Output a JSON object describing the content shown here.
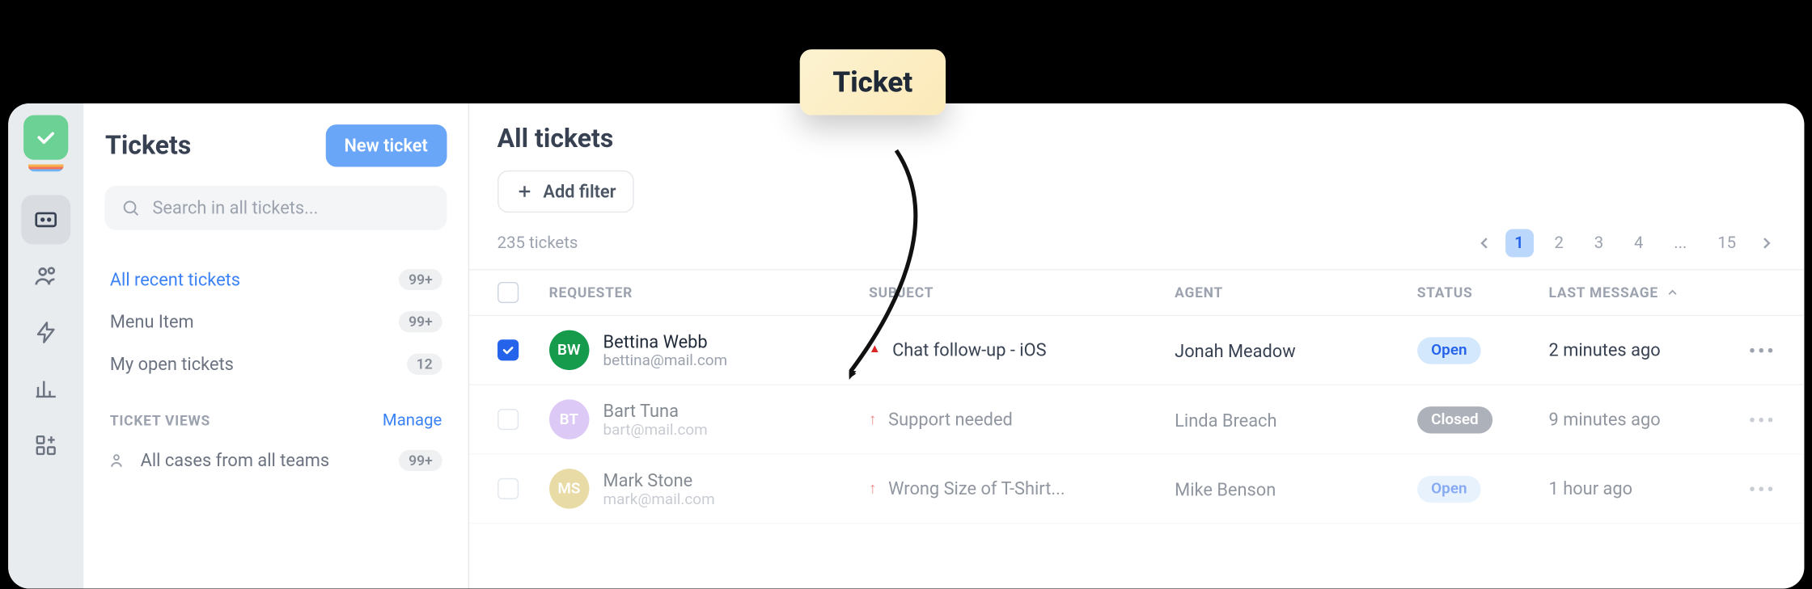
{
  "callout": {
    "label": "Ticket"
  },
  "sidebar": {
    "title": "Tickets",
    "new_button": "New ticket",
    "search_placeholder": "Search in all tickets...",
    "nav": [
      {
        "label": "All recent tickets",
        "badge": "99+",
        "active": true
      },
      {
        "label": "Menu Item",
        "badge": "99+",
        "active": false
      },
      {
        "label": "My open tickets",
        "badge": "12",
        "active": false
      }
    ],
    "views_header": "TICKET VIEWS",
    "manage": "Manage",
    "views": [
      {
        "label": "All cases from all teams",
        "badge": "99+"
      }
    ]
  },
  "main": {
    "title": "All tickets",
    "add_filter": "Add filter",
    "count": "235 tickets",
    "pages": [
      "1",
      "2",
      "3",
      "4",
      "...",
      "15"
    ],
    "active_page": "1",
    "columns": {
      "requester": "REQUESTER",
      "subject": "SUBJECT",
      "agent": "AGENT",
      "status": "STATUS",
      "last": "LAST MESSAGE"
    },
    "rows": [
      {
        "checked": true,
        "faded": false,
        "initials": "BW",
        "avatar_color": "#169b4c",
        "name": "Bettina Webb",
        "email": "bettina@mail.com",
        "priority": "high",
        "subject": "Chat follow-up - iOS",
        "agent": "Jonah Meadow",
        "status": "Open",
        "status_class": "st-open",
        "last": "2 minutes ago"
      },
      {
        "checked": false,
        "faded": true,
        "initials": "BT",
        "avatar_color": "#c39df0",
        "name": "Bart Tuna",
        "email": "bart@mail.com",
        "priority": "low",
        "subject": "Support needed",
        "agent": "Linda Breach",
        "status": "Closed",
        "status_class": "st-closed",
        "last": "9 minutes ago"
      },
      {
        "checked": false,
        "faded": true,
        "initials": "MS",
        "avatar_color": "#d7be5e",
        "name": "Mark Stone",
        "email": "mark@mail.com",
        "priority": "low",
        "subject": "Wrong Size of T-Shirt...",
        "agent": "Mike Benson",
        "status": "Open",
        "status_class": "st-open",
        "last": "1 hour ago"
      }
    ]
  }
}
